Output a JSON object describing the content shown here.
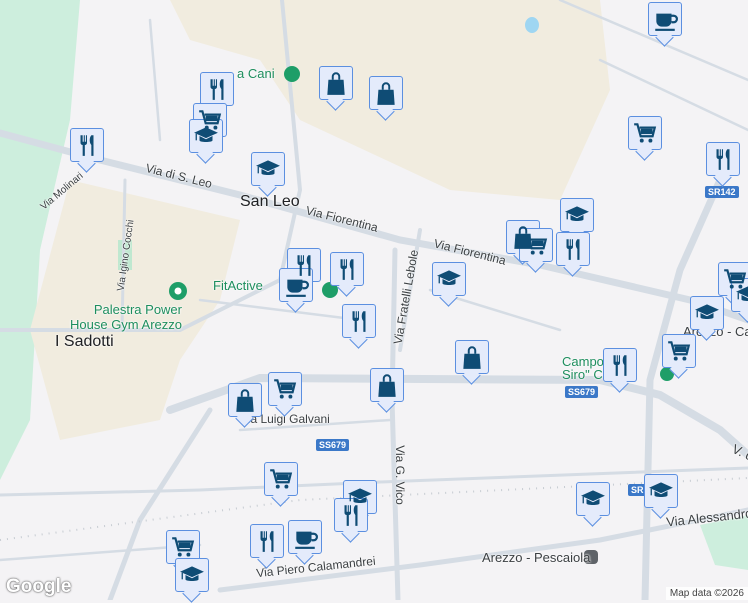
{
  "places": {
    "san_leo": "San Leo",
    "i_sadotti": "I Sadotti",
    "fitactive": "FitActive",
    "palestra_line1": "Palestra Power",
    "palestra_line2": "House Gym Arezzo",
    "area_cani": "a Cani",
    "campo": "Campo San Siro\" Ciolfi",
    "arezzo_ca": "Arezzo - Ca",
    "pescaiola": "Arezzo - Pescaiola"
  },
  "roads": {
    "via_di_s_leo": "Via di S. Leo",
    "via_fiorentina_1": "Via Fiorentina",
    "via_fiorentina_2": "Via Fiorentina",
    "via_molinari": "Via Molinari",
    "via_igino_cocchi": "Via Igino Cocchi",
    "via_fratelli_lebole": "Via Fratelli Lebole",
    "via_luigi_galvani": "Via Luigi Galvani",
    "via_g_vico": "Via G. Vico",
    "via_piero_calamandrei": "Via Piero Calamandrei",
    "via_alessandro": "Via Alessandro",
    "v_partial": "V. d"
  },
  "shields": [
    "SR142",
    "SS679",
    "SS679",
    "SR"
  ],
  "markers": [
    {
      "icon": "coffee"
    },
    {
      "icon": "restaurant"
    },
    {
      "icon": "shopping-bag"
    },
    {
      "icon": "shopping-bag"
    },
    {
      "icon": "shopping-cart"
    },
    {
      "icon": "school"
    },
    {
      "icon": "restaurant"
    },
    {
      "icon": "shopping-cart"
    },
    {
      "icon": "restaurant"
    },
    {
      "icon": "school"
    },
    {
      "icon": "school"
    },
    {
      "icon": "shopping-bag"
    },
    {
      "icon": "shopping-cart"
    },
    {
      "icon": "restaurant"
    },
    {
      "icon": "school"
    },
    {
      "icon": "restaurant"
    },
    {
      "icon": "coffee"
    },
    {
      "icon": "restaurant"
    },
    {
      "icon": "restaurant"
    },
    {
      "icon": "shopping-cart"
    },
    {
      "icon": "school"
    },
    {
      "icon": "school"
    },
    {
      "icon": "shopping-bag"
    },
    {
      "icon": "restaurant"
    },
    {
      "icon": "shopping-cart"
    },
    {
      "icon": "shopping-cart"
    },
    {
      "icon": "shopping-bag"
    },
    {
      "icon": "shopping-bag"
    },
    {
      "icon": "shopping-cart"
    },
    {
      "icon": "school"
    },
    {
      "icon": "restaurant"
    },
    {
      "icon": "school"
    },
    {
      "icon": "school"
    },
    {
      "icon": "restaurant"
    },
    {
      "icon": "coffee"
    },
    {
      "icon": "shopping-cart"
    },
    {
      "icon": "school"
    }
  ],
  "footer": {
    "logo": "Google",
    "attribution": "Map data ©2026"
  }
}
